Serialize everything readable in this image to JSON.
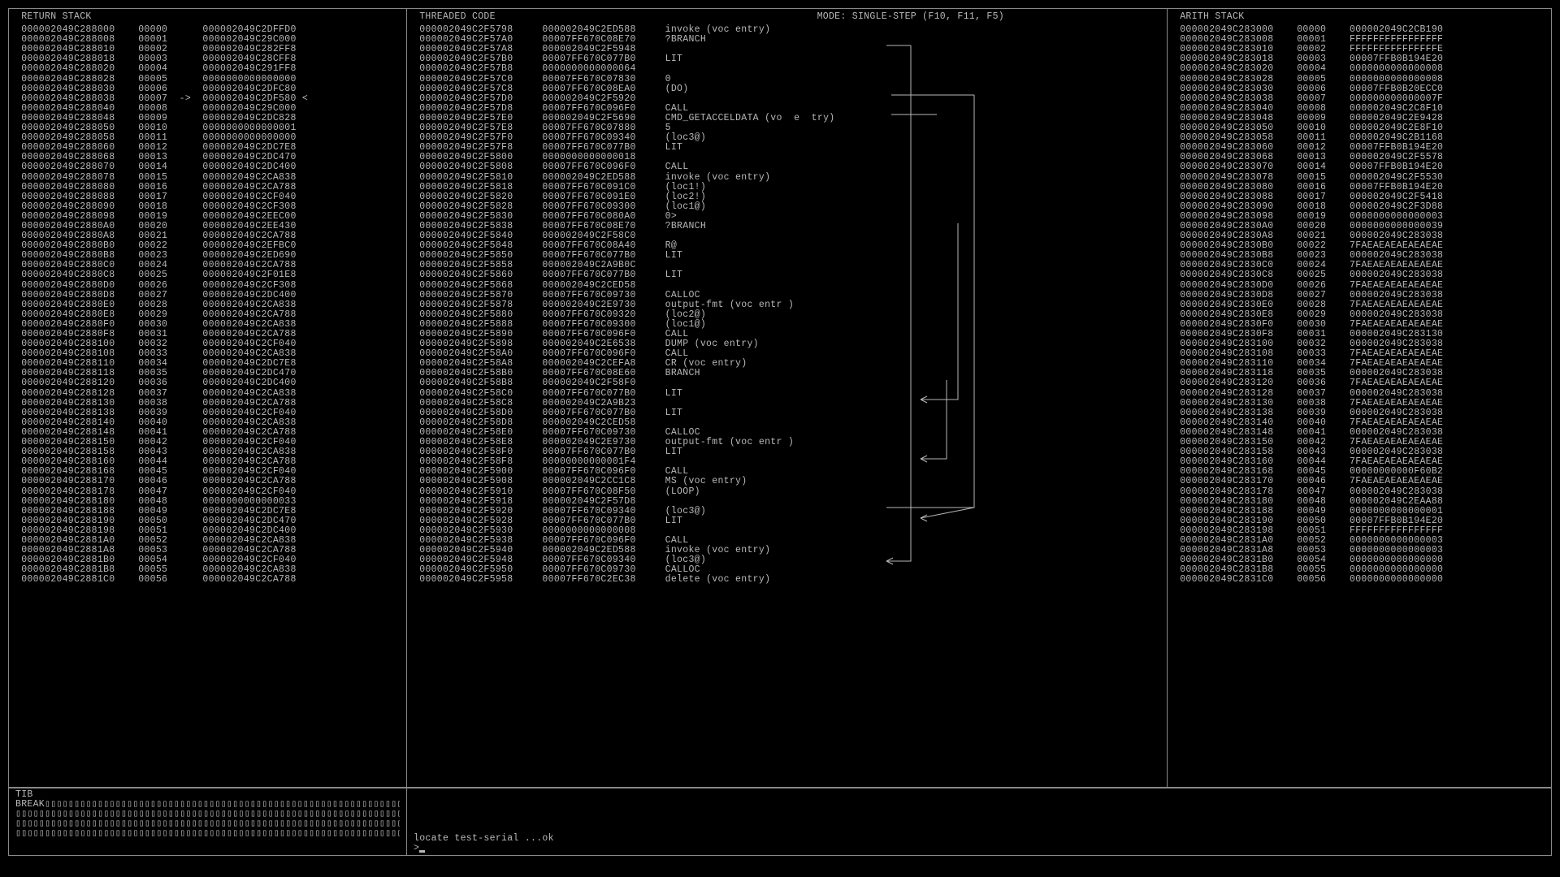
{
  "titles": {
    "return_stack": " RETURN STACK",
    "threaded_code": " THREADED CODE",
    "mode": "MODE: SINGLE-STEP (F10, F11, F5)",
    "arith_stack": " ARITH STACK",
    "tib": " TIB"
  },
  "return_stack": [
    [
      "000002049C288000",
      "00000",
      "000002049C2DFFD0"
    ],
    [
      "000002049C288008",
      "00001",
      "000002049C29C000"
    ],
    [
      "000002049C288010",
      "00002",
      "000002049C282FF8"
    ],
    [
      "000002049C288018",
      "00003",
      "000002049C28CFF8"
    ],
    [
      "000002049C288020",
      "00004",
      "000002049C291FF8"
    ],
    [
      "000002049C288028",
      "00005",
      "0000000000000000"
    ],
    [
      "000002049C288030",
      "00006",
      "000002049C2DFC80"
    ],
    [
      "000002049C288038",
      "00007",
      "000002049C2DF580",
      "->",
      "<"
    ],
    [
      "000002049C288040",
      "00008",
      "000002049C29C000"
    ],
    [
      "000002049C288048",
      "00009",
      "000002049C2DC828"
    ],
    [
      "000002049C288050",
      "00010",
      "0000000000000001"
    ],
    [
      "000002049C288058",
      "00011",
      "0000000000000000"
    ],
    [
      "000002049C288060",
      "00012",
      "000002049C2DC7E8"
    ],
    [
      "000002049C288068",
      "00013",
      "000002049C2DC470"
    ],
    [
      "000002049C288070",
      "00014",
      "000002049C2DC400"
    ],
    [
      "000002049C288078",
      "00015",
      "000002049C2CA838"
    ],
    [
      "000002049C288080",
      "00016",
      "000002049C2CA788"
    ],
    [
      "000002049C288088",
      "00017",
      "000002049C2CF040"
    ],
    [
      "000002049C288090",
      "00018",
      "000002049C2CF308"
    ],
    [
      "000002049C288098",
      "00019",
      "000002049C2EEC00"
    ],
    [
      "000002049C2880A0",
      "00020",
      "000002049C2EE430"
    ],
    [
      "000002049C2880A8",
      "00021",
      "000002049C2CA788"
    ],
    [
      "000002049C2880B0",
      "00022",
      "000002049C2EFBC0"
    ],
    [
      "000002049C2880B8",
      "00023",
      "000002049C2ED690"
    ],
    [
      "000002049C2880C0",
      "00024",
      "000002049C2CA788"
    ],
    [
      "000002049C2880C8",
      "00025",
      "000002049C2F01E8"
    ],
    [
      "000002049C2880D0",
      "00026",
      "000002049C2CF308"
    ],
    [
      "000002049C2880D8",
      "00027",
      "000002049C2DC400"
    ],
    [
      "000002049C2880E0",
      "00028",
      "000002049C2CA838"
    ],
    [
      "000002049C2880E8",
      "00029",
      "000002049C2CA788"
    ],
    [
      "000002049C2880F0",
      "00030",
      "000002049C2CA838"
    ],
    [
      "000002049C2880F8",
      "00031",
      "000002049C2CA788"
    ],
    [
      "000002049C288100",
      "00032",
      "000002049C2CF040"
    ],
    [
      "000002049C288108",
      "00033",
      "000002049C2CA838"
    ],
    [
      "000002049C288110",
      "00034",
      "000002049C2DC7E8"
    ],
    [
      "000002049C288118",
      "00035",
      "000002049C2DC470"
    ],
    [
      "000002049C288120",
      "00036",
      "000002049C2DC400"
    ],
    [
      "000002049C288128",
      "00037",
      "000002049C2CA838"
    ],
    [
      "000002049C288130",
      "00038",
      "000002049C2CA788"
    ],
    [
      "000002049C288138",
      "00039",
      "000002049C2CF040"
    ],
    [
      "000002049C288140",
      "00040",
      "000002049C2CA838"
    ],
    [
      "000002049C288148",
      "00041",
      "000002049C2CA788"
    ],
    [
      "000002049C288150",
      "00042",
      "000002049C2CF040"
    ],
    [
      "000002049C288158",
      "00043",
      "000002049C2CA838"
    ],
    [
      "000002049C288160",
      "00044",
      "000002049C2CA788"
    ],
    [
      "000002049C288168",
      "00045",
      "000002049C2CF040"
    ],
    [
      "000002049C288170",
      "00046",
      "000002049C2CA788"
    ],
    [
      "000002049C288178",
      "00047",
      "000002049C2CF040"
    ],
    [
      "000002049C288180",
      "00048",
      "0000000000000033"
    ],
    [
      "000002049C288188",
      "00049",
      "000002049C2DC7E8"
    ],
    [
      "000002049C288190",
      "00050",
      "000002049C2DC470"
    ],
    [
      "000002049C288198",
      "00051",
      "000002049C2DC400"
    ],
    [
      "000002049C2881A0",
      "00052",
      "000002049C2CA838"
    ],
    [
      "000002049C2881A8",
      "00053",
      "000002049C2CA788"
    ],
    [
      "000002049C2881B0",
      "00054",
      "000002049C2CF040"
    ],
    [
      "000002049C2881B8",
      "00055",
      "000002049C2CA838"
    ],
    [
      "000002049C2881C0",
      "00056",
      "000002049C2CA788"
    ]
  ],
  "threaded_code": [
    [
      "000002049C2F5798",
      "000002049C2ED588",
      "invoke (voc entry)"
    ],
    [
      "000002049C2F57A0",
      "00007FF670C08E70",
      "?BRANCH"
    ],
    [
      "000002049C2F57A8",
      "000002049C2F5948",
      ""
    ],
    [
      "000002049C2F57B0",
      "00007FF670C077B0",
      "LIT"
    ],
    [
      "000002049C2F57B8",
      "0000000000000064",
      ""
    ],
    [
      "000002049C2F57C0",
      "00007FF670C07830",
      "0"
    ],
    [
      "000002049C2F57C8",
      "00007FF670C08EA0",
      "(DO)"
    ],
    [
      "000002049C2F57D0",
      "000002049C2F5920",
      ""
    ],
    [
      "000002049C2F57D8",
      "00007FF670C096F0",
      "CALL"
    ],
    [
      "000002049C2F57E0",
      "000002049C2F5690",
      "CMD_GETACCELDATA (vo  e  try)"
    ],
    [
      "000002049C2F57E8",
      "00007FF670C07880",
      "5"
    ],
    [
      "000002049C2F57F0",
      "00007FF670C09340",
      "(loc3@)"
    ],
    [
      "000002049C2F57F8",
      "00007FF670C077B0",
      "LIT"
    ],
    [
      "000002049C2F5800",
      "0000000000000018",
      ""
    ],
    [
      "000002049C2F5808",
      "00007FF670C096F0",
      "CALL"
    ],
    [
      "000002049C2F5810",
      "000002049C2ED588",
      "invoke (voc entry)"
    ],
    [
      "000002049C2F5818",
      "00007FF670C091C0",
      "(loc1!)"
    ],
    [
      "000002049C2F5820",
      "00007FF670C091E0",
      "(loc2!)"
    ],
    [
      "000002049C2F5828",
      "00007FF670C09300",
      "(loc1@)"
    ],
    [
      "000002049C2F5830",
      "00007FF670C080A0",
      "0>"
    ],
    [
      "000002049C2F5838",
      "00007FF670C08E70",
      "?BRANCH"
    ],
    [
      "000002049C2F5840",
      "000002049C2F58C0",
      ""
    ],
    [
      "000002049C2F5848",
      "00007FF670C08A40",
      "R@"
    ],
    [
      "000002049C2F5850",
      "00007FF670C077B0",
      "LIT"
    ],
    [
      "000002049C2F5858",
      "000002049C2A9B0C",
      ""
    ],
    [
      "000002049C2F5860",
      "00007FF670C077B0",
      "LIT"
    ],
    [
      "000002049C2F5868",
      "000002049C2CED58",
      ""
    ],
    [
      "000002049C2F5870",
      "00007FF670C09730",
      "CALLOC"
    ],
    [
      "000002049C2F5878",
      "000002049C2E9730",
      "output-fmt (voc entr )"
    ],
    [
      "000002049C2F5880",
      "00007FF670C09320",
      "(loc2@)"
    ],
    [
      "000002049C2F5888",
      "00007FF670C09300",
      "(loc1@)"
    ],
    [
      "000002049C2F5890",
      "00007FF670C096F0",
      "CALL"
    ],
    [
      "000002049C2F5898",
      "000002049C2E6538",
      "DUMP (voc entry)"
    ],
    [
      "000002049C2F58A0",
      "00007FF670C096F0",
      "CALL"
    ],
    [
      "000002049C2F58A8",
      "000002049C2CEFA8",
      "CR (voc entry)"
    ],
    [
      "000002049C2F58B0",
      "00007FF670C08E60",
      "BRANCH"
    ],
    [
      "000002049C2F58B8",
      "000002049C2F58F0",
      ""
    ],
    [
      "000002049C2F58C0",
      "00007FF670C077B0",
      "LIT"
    ],
    [
      "000002049C2F58C8",
      "000002049C2A9B23",
      ""
    ],
    [
      "000002049C2F58D0",
      "00007FF670C077B0",
      "LIT"
    ],
    [
      "000002049C2F58D8",
      "000002049C2CED58",
      ""
    ],
    [
      "000002049C2F58E0",
      "00007FF670C09730",
      "CALLOC"
    ],
    [
      "000002049C2F58E8",
      "000002049C2E9730",
      "output-fmt (voc entr )"
    ],
    [
      "000002049C2F58F0",
      "00007FF670C077B0",
      "LIT"
    ],
    [
      "000002049C2F58F8",
      "00000000000001F4",
      ""
    ],
    [
      "000002049C2F5900",
      "00007FF670C096F0",
      "CALL"
    ],
    [
      "000002049C2F5908",
      "000002049C2CC1C8",
      "MS (voc entry)"
    ],
    [
      "000002049C2F5910",
      "00007FF670C08F50",
      "(LOOP)"
    ],
    [
      "000002049C2F5918",
      "000002049C2F57D8",
      ""
    ],
    [
      "000002049C2F5920",
      "00007FF670C09340",
      "(loc3@)"
    ],
    [
      "000002049C2F5928",
      "00007FF670C077B0",
      "LIT"
    ],
    [
      "000002049C2F5930",
      "0000000000000008",
      ""
    ],
    [
      "000002049C2F5938",
      "00007FF670C096F0",
      "CALL"
    ],
    [
      "000002049C2F5940",
      "000002049C2ED588",
      "invoke (voc entry)"
    ],
    [
      "000002049C2F5948",
      "00007FF670C09340",
      "(loc3@)"
    ],
    [
      "000002049C2F5950",
      "00007FF670C09730",
      "CALLOC"
    ],
    [
      "000002049C2F5958",
      "00007FF670C2EC38",
      "delete (voc entry)"
    ]
  ],
  "arith_stack": [
    [
      "000002049C283000",
      "00000",
      "000002049C2CB190"
    ],
    [
      "000002049C283008",
      "00001",
      "FFFFFFFFFFFFFFFF"
    ],
    [
      "000002049C283010",
      "00002",
      "FFFFFFFFFFFFFFFE"
    ],
    [
      "000002049C283018",
      "00003",
      "00007FFB0B194E20"
    ],
    [
      "000002049C283020",
      "00004",
      "0000000000000008"
    ],
    [
      "000002049C283028",
      "00005",
      "0000000000000008"
    ],
    [
      "000002049C283030",
      "00006",
      "00007FFB0B20ECC0"
    ],
    [
      "000002049C283038",
      "00007",
      "000000000000007F"
    ],
    [
      "000002049C283040",
      "00008",
      "000002049C2C8F10"
    ],
    [
      "000002049C283048",
      "00009",
      "000002049C2E9428"
    ],
    [
      "000002049C283050",
      "00010",
      "000002049C2E8F10"
    ],
    [
      "000002049C283058",
      "00011",
      "000002049C2B1168"
    ],
    [
      "000002049C283060",
      "00012",
      "00007FFB0B194E20"
    ],
    [
      "000002049C283068",
      "00013",
      "000002049C2F5578"
    ],
    [
      "000002049C283070",
      "00014",
      "00007FFB0B194E20"
    ],
    [
      "000002049C283078",
      "00015",
      "000002049C2F5530"
    ],
    [
      "000002049C283080",
      "00016",
      "00007FFB0B194E20"
    ],
    [
      "000002049C283088",
      "00017",
      "000002049C2F5418"
    ],
    [
      "000002049C283090",
      "00018",
      "000002049C2F3D88"
    ],
    [
      "000002049C283098",
      "00019",
      "0000000000000003"
    ],
    [
      "000002049C2830A0",
      "00020",
      "0000000000000039"
    ],
    [
      "000002049C2830A8",
      "00021",
      "000002049C283038"
    ],
    [
      "000002049C2830B0",
      "00022",
      "7FAEAEAEAEAEAEAE"
    ],
    [
      "000002049C2830B8",
      "00023",
      "000002049C283038"
    ],
    [
      "000002049C2830C0",
      "00024",
      "7FAEAEAEAEAEAEAE"
    ],
    [
      "000002049C2830C8",
      "00025",
      "000002049C283038"
    ],
    [
      "000002049C2830D0",
      "00026",
      "7FAEAEAEAEAEAEAE"
    ],
    [
      "000002049C2830D8",
      "00027",
      "000002049C283038"
    ],
    [
      "000002049C2830E0",
      "00028",
      "7FAEAEAEAEAEAEAE"
    ],
    [
      "000002049C2830E8",
      "00029",
      "000002049C283038"
    ],
    [
      "000002049C2830F0",
      "00030",
      "7FAEAEAEAEAEAEAE"
    ],
    [
      "000002049C2830F8",
      "00031",
      "000002049C283130"
    ],
    [
      "000002049C283100",
      "00032",
      "000002049C283038"
    ],
    [
      "000002049C283108",
      "00033",
      "7FAEAEAEAEAEAEAE"
    ],
    [
      "000002049C283110",
      "00034",
      "7FAEAEAEAEAEAEAE"
    ],
    [
      "000002049C283118",
      "00035",
      "000002049C283038"
    ],
    [
      "000002049C283120",
      "00036",
      "7FAEAEAEAEAEAEAE"
    ],
    [
      "000002049C283128",
      "00037",
      "000002049C283038"
    ],
    [
      "000002049C283130",
      "00038",
      "7FAEAEAEAEAEAEAE"
    ],
    [
      "000002049C283138",
      "00039",
      "000002049C283038"
    ],
    [
      "000002049C283140",
      "00040",
      "7FAEAEAEAEAEAEAE"
    ],
    [
      "000002049C283148",
      "00041",
      "000002049C283038"
    ],
    [
      "000002049C283150",
      "00042",
      "7FAEAEAEAEAEAEAE"
    ],
    [
      "000002049C283158",
      "00043",
      "000002049C283038"
    ],
    [
      "000002049C283160",
      "00044",
      "7FAEAEAEAEAEAEAE"
    ],
    [
      "000002049C283168",
      "00045",
      "00000000000F60B2"
    ],
    [
      "000002049C283170",
      "00046",
      "7FAEAEAEAEAEAEAE"
    ],
    [
      "000002049C283178",
      "00047",
      "000002049C283038"
    ],
    [
      "000002049C283180",
      "00048",
      "000002049C2EAA88"
    ],
    [
      "000002049C283188",
      "00049",
      "0000000000000001"
    ],
    [
      "000002049C283190",
      "00050",
      "00007FFB0B194E20"
    ],
    [
      "000002049C283198",
      "00051",
      "FFFFFFFFFFFFFFFF"
    ],
    [
      "000002049C2831A0",
      "00052",
      "0000000000000003"
    ],
    [
      "000002049C2831A8",
      "00053",
      "0000000000000003"
    ],
    [
      "000002049C2831B0",
      "00054",
      "0000000000000000"
    ],
    [
      "000002049C2831B8",
      "00055",
      "0000000000000000"
    ],
    [
      "000002049C2831C0",
      "00056",
      "0000000000000000"
    ]
  ],
  "tib": {
    "break": "BREAK",
    "fill": "▯▯▯▯▯▯▯▯▯▯▯▯▯▯▯▯▯▯▯▯▯▯▯▯▯▯▯▯▯▯▯▯▯▯▯▯▯▯▯▯▯▯▯▯▯▯▯▯▯▯▯▯▯▯▯▯▯▯▯▯▯▯▯▯▯▯▯▯"
  },
  "console": {
    "line": "locate test-serial ...ok",
    "prompt": ">"
  }
}
